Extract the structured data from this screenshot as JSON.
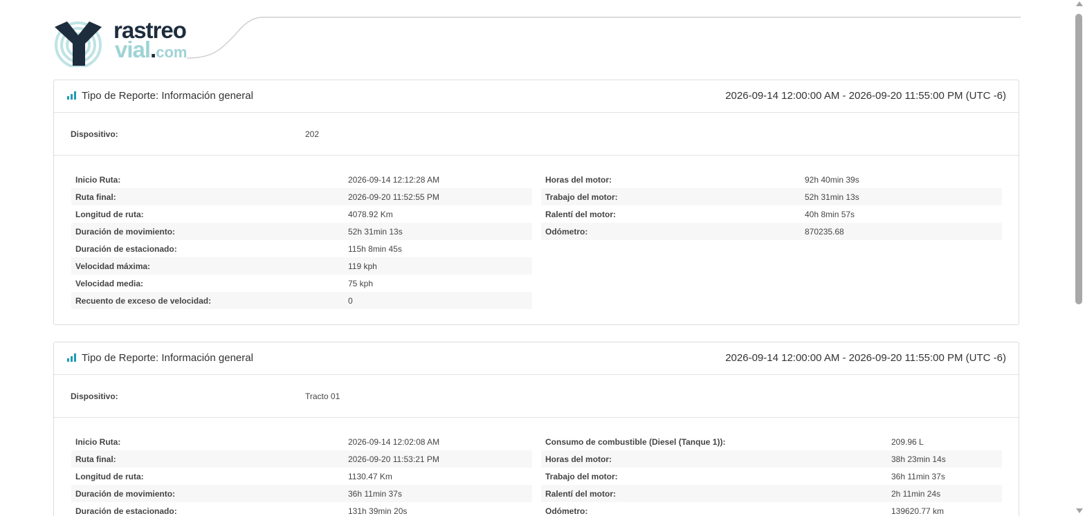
{
  "logo": {
    "line1": "rastreo",
    "line2_main": "vial",
    "line2_dot": ".",
    "line2_tld": "com"
  },
  "reports": [
    {
      "title": "Tipo de Reporte: Información general",
      "range": "2026-09-14 12:00:00 AM - 2026-09-20 11:55:00 PM (UTC -6)",
      "device_label": "Dispositivo:",
      "device_value": "202",
      "left": [
        {
          "label": "Inicio Ruta:",
          "value": "2026-09-14 12:12:28 AM"
        },
        {
          "label": "Ruta final:",
          "value": "2026-09-20 11:52:55 PM"
        },
        {
          "label": "Longitud de ruta:",
          "value": "4078.92 Km"
        },
        {
          "label": "Duración de movimiento:",
          "value": "52h 31min 13s"
        },
        {
          "label": "Duración de estacionado:",
          "value": "115h 8min 45s"
        },
        {
          "label": "Velocidad máxima:",
          "value": "119 kph"
        },
        {
          "label": "Velocidad media:",
          "value": "75 kph"
        },
        {
          "label": "Recuento de exceso de velocidad:",
          "value": "0"
        }
      ],
      "right": [
        {
          "label": "Horas del motor:",
          "value": "92h 40min 39s"
        },
        {
          "label": "Trabajo del motor:",
          "value": "52h 31min 13s"
        },
        {
          "label": "Ralentí del motor:",
          "value": "40h 8min 57s"
        },
        {
          "label": "Odómetro:",
          "value": "870235.68"
        }
      ]
    },
    {
      "title": "Tipo de Reporte: Información general",
      "range": "2026-09-14 12:00:00 AM - 2026-09-20 11:55:00 PM (UTC -6)",
      "device_label": "Dispositivo:",
      "device_value": "Tracto 01",
      "left": [
        {
          "label": "Inicio Ruta:",
          "value": "2026-09-14 12:02:08 AM"
        },
        {
          "label": "Ruta final:",
          "value": "2026-09-20 11:53:21 PM"
        },
        {
          "label": "Longitud de ruta:",
          "value": "1130.47 Km"
        },
        {
          "label": "Duración de movimiento:",
          "value": "36h 11min 37s"
        },
        {
          "label": "Duración de estacionado:",
          "value": "131h 39min 20s"
        }
      ],
      "right": [
        {
          "label": "Consumo de combustible (Diesel (Tanque 1)):",
          "value": "209.96 L"
        },
        {
          "label": "Horas del motor:",
          "value": "38h 23min 14s"
        },
        {
          "label": "Trabajo del motor:",
          "value": "36h 11min 37s"
        },
        {
          "label": "Ralentí del motor:",
          "value": "2h 11min 24s"
        },
        {
          "label": "Odómetro:",
          "value": "139620.77 km"
        }
      ]
    }
  ],
  "colors": {
    "accent": "#1e9bb5",
    "brand_dark": "#1d2d3d",
    "brand_light": "#9fd3d6"
  },
  "icons": {
    "report_icon": "bar-chart-icon",
    "logo_icon": "rastreo-vial-logo-icon"
  }
}
